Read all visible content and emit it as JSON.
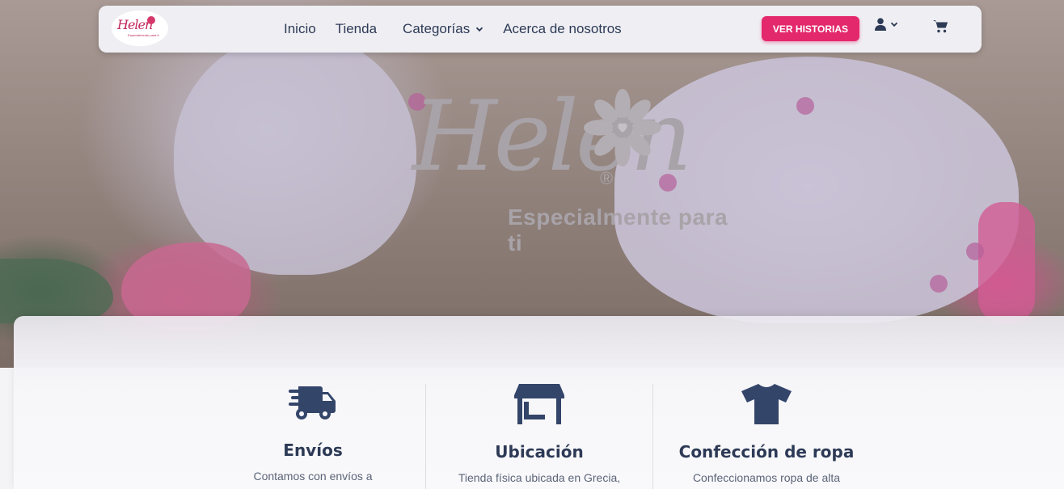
{
  "brand": {
    "logo_word": "Helen",
    "tagline": "Especialmente para ti",
    "registered_mark": "®",
    "mini_tagline": "Especialmente para ti"
  },
  "nav": {
    "links": [
      {
        "label": "Inicio"
      },
      {
        "label": "Tienda"
      },
      {
        "label": "Categorías"
      },
      {
        "label": "Acerca de nosotros"
      }
    ],
    "cta_label": "VER HISTORIAS"
  },
  "features": [
    {
      "icon": "truck-icon",
      "title": "Envíos",
      "text": "Contamos con envíos a"
    },
    {
      "icon": "store-icon",
      "title": "Ubicación",
      "text": "Tienda física ubicada en Grecia,"
    },
    {
      "icon": "shirt-icon",
      "title": "Confección de ropa",
      "text": "Confeccionamos ropa de alta"
    }
  ],
  "colors": {
    "accent": "#e3286b",
    "navy": "#2d3a56",
    "icon": "#34456a"
  }
}
